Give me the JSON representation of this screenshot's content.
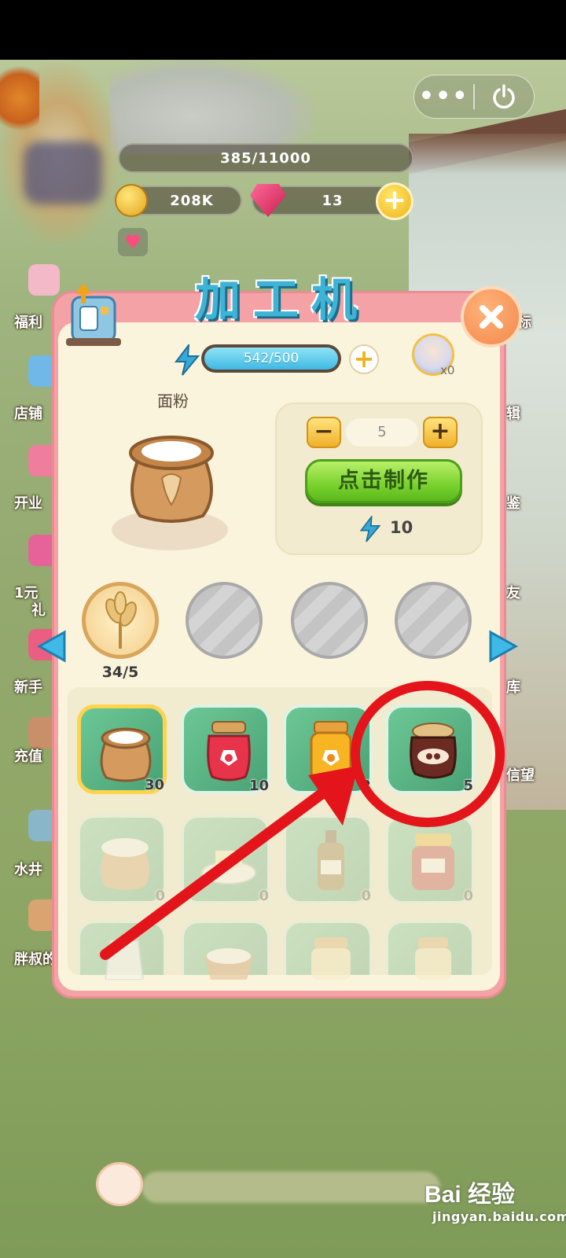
{
  "capsule": {
    "more_icon": "more-dots-icon",
    "close_icon": "power-icon"
  },
  "resources": {
    "xp": "385/11000",
    "coins": "208K",
    "gems": "13"
  },
  "side_menu": [
    {
      "label": "福利",
      "icon": "gift-vip-icon"
    },
    {
      "label": "店铺",
      "icon": "camera-shop-icon"
    },
    {
      "label": "开业",
      "icon": "gift-box-icon"
    },
    {
      "label": "1元",
      "label2": "礼",
      "icon": "gift-icon"
    },
    {
      "label": "新手",
      "icon": "gift-icon"
    },
    {
      "label": "充值",
      "icon": "girl-icon"
    },
    {
      "label": "水井",
      "icon": "well-icon"
    },
    {
      "label": "胖叔的",
      "icon": "chef-icon"
    }
  ],
  "right_menu": [
    {
      "label": "标"
    },
    {
      "label": "辑"
    },
    {
      "label": "鉴"
    },
    {
      "label": "友"
    },
    {
      "label": "库"
    },
    {
      "label": "信望"
    }
  ],
  "panel": {
    "title": "加工机",
    "energy": {
      "value": "542/500",
      "current": 542,
      "max": 500
    },
    "helper_count": "x0",
    "item_name": "面粉",
    "quantity": "5",
    "craft_button": "点击制作",
    "energy_cost": "10",
    "ingredient_slots": [
      {
        "icon": "wheat-icon",
        "label": "34/5",
        "active": true
      },
      {
        "icon": "empty-slot",
        "active": false
      },
      {
        "icon": "empty-slot",
        "active": false
      },
      {
        "icon": "empty-slot",
        "active": false
      }
    ],
    "products": [
      {
        "name": "flour-sack",
        "count": "30",
        "selected": true,
        "faded": false
      },
      {
        "name": "strawberry-jam",
        "count": "10",
        "selected": false,
        "faded": false
      },
      {
        "name": "orange-jam",
        "count": "2",
        "selected": false,
        "faded": false
      },
      {
        "name": "chocolate-jam",
        "count": "5",
        "selected": false,
        "faded": false
      },
      {
        "name": "flour-mix",
        "count": "0",
        "selected": false,
        "faded": true
      },
      {
        "name": "butter-plate",
        "count": "0",
        "selected": false,
        "faded": true
      },
      {
        "name": "oil-bottle",
        "count": "0",
        "selected": false,
        "faded": true
      },
      {
        "name": "red-bean-jar",
        "count": "0",
        "selected": false,
        "faded": true
      },
      {
        "name": "milk-jug",
        "count": "",
        "selected": false,
        "faded": true
      },
      {
        "name": "sugar-bowl",
        "count": "",
        "selected": false,
        "faded": true
      },
      {
        "name": "empty-jar",
        "count": "",
        "selected": false,
        "faded": true
      },
      {
        "name": "glass-jar",
        "count": "",
        "selected": false,
        "faded": true
      }
    ]
  },
  "annotation": {
    "color": "#e4141b"
  },
  "watermark": {
    "logo": "Bai 经验",
    "sub": "jingyan.baidu.com"
  }
}
